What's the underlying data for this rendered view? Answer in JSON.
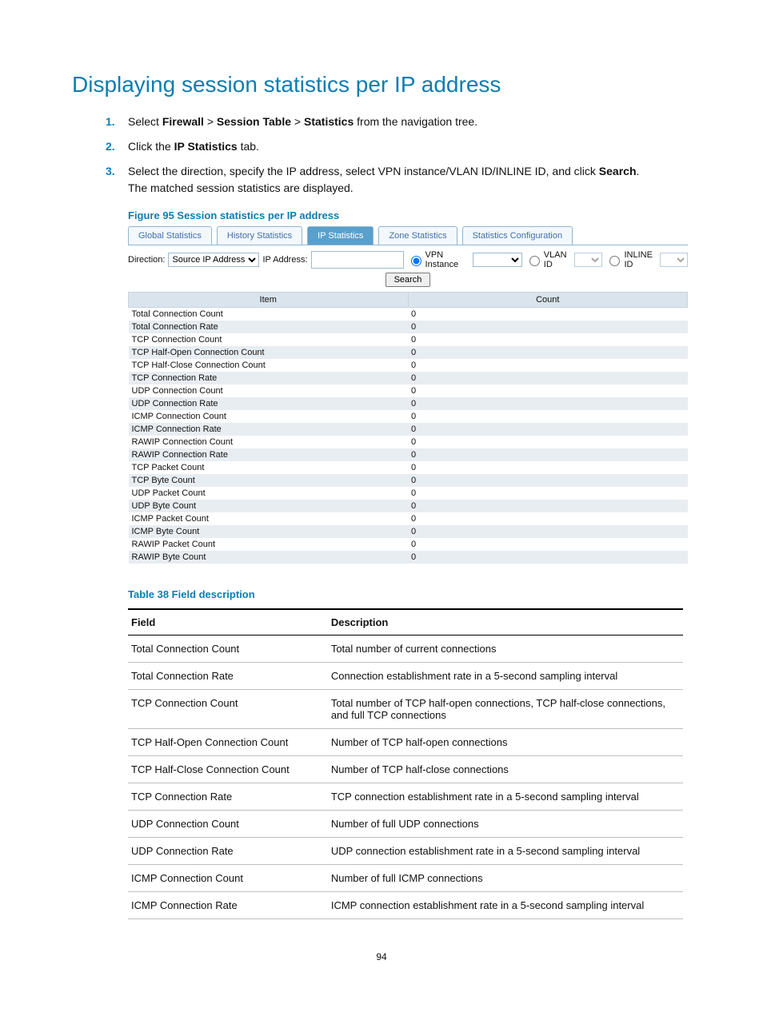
{
  "title": "Displaying session statistics per IP address",
  "steps": [
    {
      "num": "1.",
      "html": "Select <b>Firewall</b> > <b>Session Table</b> > <b>Statistics</b> from the navigation tree."
    },
    {
      "num": "2.",
      "html": "Click the <b>IP Statistics</b> tab."
    },
    {
      "num": "3.",
      "html": "Select the direction, specify the IP address, select VPN instance/VLAN ID/INLINE ID, and click <b>Search</b>.<br>The matched session statistics are displayed."
    }
  ],
  "fig_caption": "Figure 95 Session statistics per IP address",
  "sshot": {
    "tabs": [
      "Global Statistics",
      "History Statistics",
      "IP Statistics",
      "Zone Statistics",
      "Statistics Configuration"
    ],
    "active_tab_idx": 2,
    "labels": {
      "direction": "Direction:",
      "ip": "IP Address:",
      "vpn": "VPN Instance",
      "vlan": "VLAN ID",
      "inline": "INLINE ID",
      "search": "Search"
    },
    "direction_value": "Source IP Address",
    "headers": [
      "Item",
      "Count"
    ],
    "rows": [
      {
        "item": "Total Connection Count",
        "count": "0",
        "indent": 0
      },
      {
        "item": "Total Connection Rate",
        "count": "0",
        "indent": 0
      },
      {
        "item": "TCP Connection Count",
        "count": "0",
        "indent": 0
      },
      {
        "item": "TCP Half-Open Connection Count",
        "count": "0",
        "indent": 1
      },
      {
        "item": "TCP Half-Close Connection Count",
        "count": "0",
        "indent": 1
      },
      {
        "item": "TCP Connection Rate",
        "count": "0",
        "indent": 0
      },
      {
        "item": "UDP Connection Count",
        "count": "0",
        "indent": 0
      },
      {
        "item": "UDP Connection Rate",
        "count": "0",
        "indent": 0
      },
      {
        "item": "ICMP Connection Count",
        "count": "0",
        "indent": 0
      },
      {
        "item": "ICMP Connection Rate",
        "count": "0",
        "indent": 0
      },
      {
        "item": "RAWIP Connection Count",
        "count": "0",
        "indent": 0
      },
      {
        "item": "RAWIP Connection Rate",
        "count": "0",
        "indent": 0
      },
      {
        "item": "TCP Packet Count",
        "count": "0",
        "indent": 0
      },
      {
        "item": "TCP Byte Count",
        "count": "0",
        "indent": 0
      },
      {
        "item": "UDP Packet Count",
        "count": "0",
        "indent": 0
      },
      {
        "item": "UDP Byte Count",
        "count": "0",
        "indent": 0
      },
      {
        "item": "ICMP Packet Count",
        "count": "0",
        "indent": 0
      },
      {
        "item": "ICMP Byte Count",
        "count": "0",
        "indent": 0
      },
      {
        "item": "RAWIP Packet Count",
        "count": "0",
        "indent": 0
      },
      {
        "item": "RAWIP Byte Count",
        "count": "0",
        "indent": 0
      }
    ]
  },
  "tbl_caption": "Table 38 Field description",
  "desc": {
    "headers": [
      "Field",
      "Description"
    ],
    "rows": [
      [
        "Total Connection Count",
        "Total number of current connections"
      ],
      [
        "Total Connection Rate",
        "Connection establishment rate in a 5-second sampling interval"
      ],
      [
        "TCP Connection Count",
        "Total number of TCP half-open connections, TCP half-close connections, and full TCP connections"
      ],
      [
        "TCP Half-Open Connection Count",
        "Number of TCP half-open connections"
      ],
      [
        "TCP Half-Close Connection Count",
        "Number of TCP half-close connections"
      ],
      [
        "TCP Connection Rate",
        "TCP connection establishment rate in a 5-second sampling interval"
      ],
      [
        "UDP Connection Count",
        "Number of full UDP connections"
      ],
      [
        "UDP Connection Rate",
        "UDP connection establishment rate in a 5-second sampling interval"
      ],
      [
        "ICMP Connection Count",
        "Number of full ICMP connections"
      ],
      [
        "ICMP Connection Rate",
        "ICMP connection establishment rate in a 5-second sampling interval"
      ]
    ]
  },
  "page_num": "94"
}
